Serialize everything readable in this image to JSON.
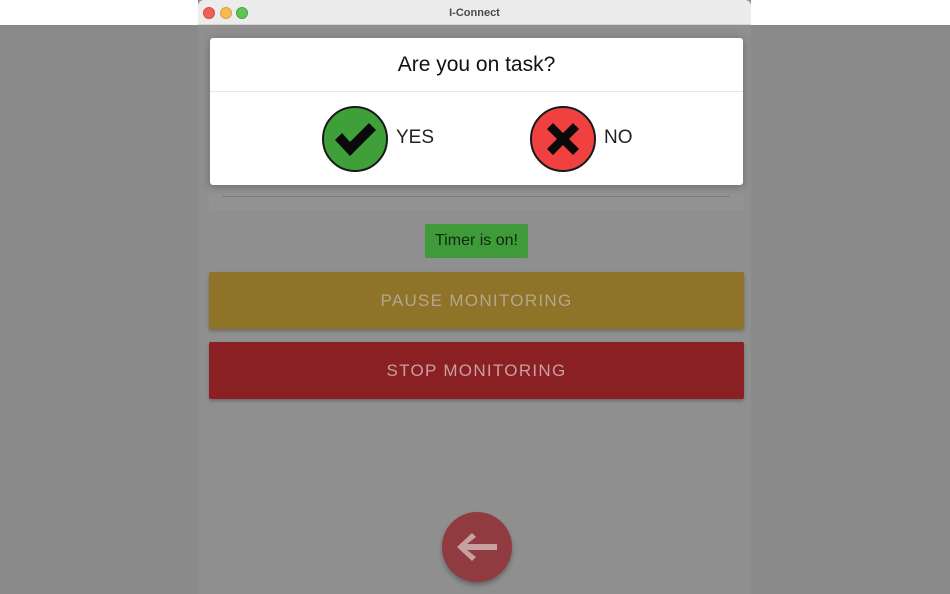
{
  "window": {
    "title": "I-Connect"
  },
  "modal": {
    "question": "Are you on task?",
    "yes_label": "YES",
    "no_label": "NO",
    "yes_icon": "checkmark-icon",
    "no_icon": "x-mark-icon"
  },
  "status": {
    "timer_text": "Timer is on!"
  },
  "buttons": {
    "pause_label": "PAUSE MONITORING",
    "stop_label": "STOP MONITORING",
    "back_icon": "arrow-left-icon"
  },
  "colors": {
    "yes_green": "#3fa03a",
    "no_red": "#f04040",
    "pause_yellow": "#8e7328",
    "stop_red": "#8a2023",
    "timer_green": "#3f9a3a"
  }
}
